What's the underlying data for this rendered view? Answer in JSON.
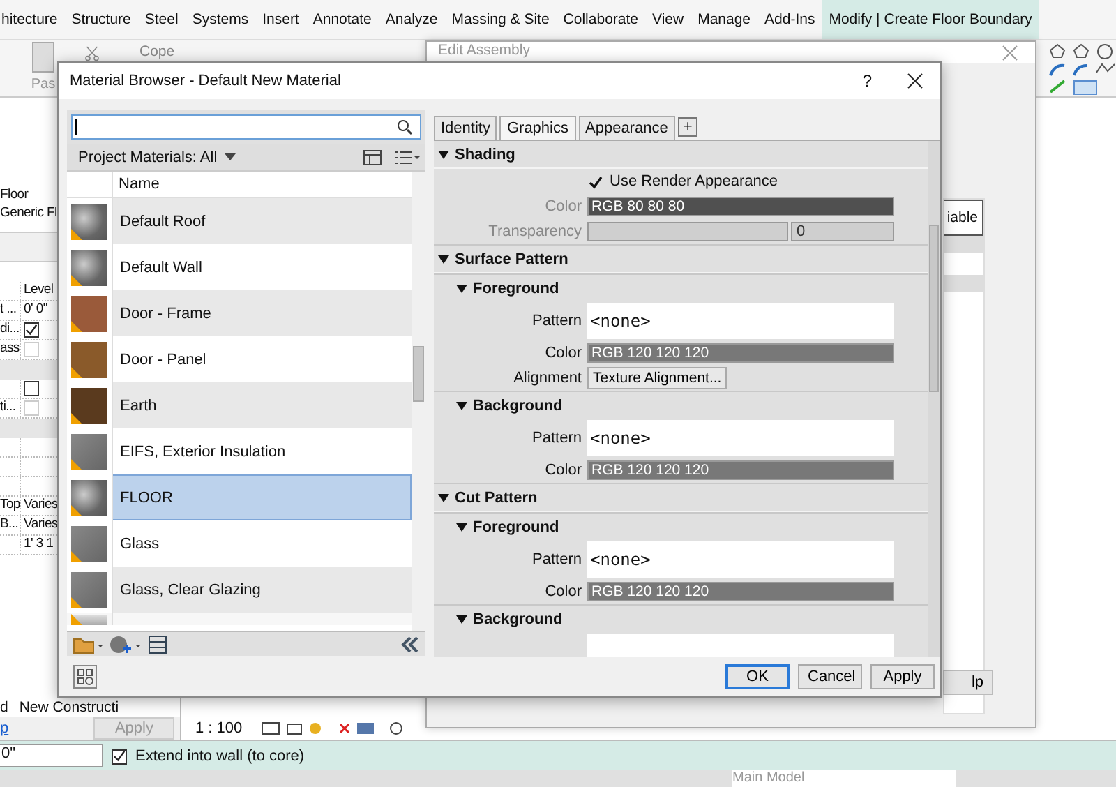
{
  "ribbon": {
    "tabs": [
      {
        "label": "hitecture",
        "selected": false
      },
      {
        "label": "Structure",
        "selected": false
      },
      {
        "label": "Steel",
        "selected": false
      },
      {
        "label": "Systems",
        "selected": false
      },
      {
        "label": "Insert",
        "selected": false
      },
      {
        "label": "Annotate",
        "selected": false
      },
      {
        "label": "Analyze",
        "selected": false
      },
      {
        "label": "Massing & Site",
        "selected": false
      },
      {
        "label": "Collaborate",
        "selected": false
      },
      {
        "label": "View",
        "selected": false
      },
      {
        "label": "Manage",
        "selected": false
      },
      {
        "label": "Add-Ins",
        "selected": false
      },
      {
        "label": "Modify | Create Floor Boundary",
        "selected": true
      }
    ],
    "paste_label": "Pas",
    "cope_label": "Cope"
  },
  "properties": {
    "type_lines": [
      "Floor",
      "Generic Fl"
    ],
    "rows": [
      {
        "kind": "text",
        "value": "Level"
      },
      {
        "kind": "text",
        "label": "t ...",
        "value": "0'  0\""
      },
      {
        "kind": "check",
        "label": "di...",
        "checked": true,
        "disabled": false
      },
      {
        "kind": "check",
        "label": "ass",
        "checked": false,
        "disabled": true
      },
      {
        "kind": "band"
      },
      {
        "kind": "check",
        "checked": false,
        "disabled": false
      },
      {
        "kind": "check",
        "label": "ti...",
        "checked": false,
        "disabled": true
      },
      {
        "kind": "band"
      },
      {
        "kind": "text"
      },
      {
        "kind": "text"
      },
      {
        "kind": "text"
      },
      {
        "kind": "text",
        "label": "Top",
        "value": "Varies"
      },
      {
        "kind": "text",
        "label": "B...",
        "value": "Varies"
      },
      {
        "kind": "text",
        "value": "1'  3 1"
      }
    ],
    "phase_label": "d",
    "phase_value": "New Constructi",
    "help_link": "p",
    "apply": {
      "label": "Apply",
      "disabled": true
    }
  },
  "view_bar": {
    "scale": "1 : 100"
  },
  "options_bar": {
    "offset_value": "0\"",
    "extend_label": "Extend into wall (to core)",
    "extend_checked": true
  },
  "status_bar": {
    "model": "Main Model"
  },
  "edit_assembly": {
    "title": "Edit Assembly",
    "column_header": "iable",
    "help_button": "lp"
  },
  "material_browser": {
    "title": "Material Browser - Default New Material",
    "help": "?",
    "filter": "Project Materials: All",
    "column": "Name",
    "materials": [
      {
        "name": "Default Roof",
        "kind": "sphere",
        "selected": false
      },
      {
        "name": "Default Wall",
        "kind": "sphere",
        "selected": false
      },
      {
        "name": "Door - Frame",
        "kind": "wood",
        "selected": false
      },
      {
        "name": "Door - Panel",
        "kind": "panel",
        "selected": false
      },
      {
        "name": "Earth",
        "kind": "earth",
        "selected": false
      },
      {
        "name": "EIFS, Exterior Insulation",
        "kind": "box",
        "selected": false
      },
      {
        "name": "FLOOR",
        "kind": "sphere",
        "selected": true
      },
      {
        "name": "Glass",
        "kind": "box",
        "selected": false
      },
      {
        "name": "Glass, Clear Glazing",
        "kind": "box",
        "selected": false
      },
      {
        "kind": "slab",
        "selected": false
      }
    ],
    "tabs": [
      {
        "label": "Identity",
        "selected": false
      },
      {
        "label": "Graphics",
        "selected": true
      },
      {
        "label": "Appearance",
        "selected": false
      },
      {
        "label": "+",
        "selected": false
      }
    ],
    "sections": [
      {
        "title": "Shading",
        "expanded": true,
        "rows": [
          {
            "kind": "checkbox",
            "label": "Use Render Appearance",
            "checked": true
          },
          {
            "kind": "swatch",
            "label": "Color",
            "value": "RGB 80 80 80",
            "color": "#505050",
            "disabled": true
          },
          {
            "kind": "slider",
            "label": "Transparency",
            "value": "0",
            "disabled": true
          }
        ]
      },
      {
        "title": "Surface Pattern",
        "expanded": true,
        "groups": [
          {
            "title": "Foreground",
            "expanded": true,
            "rows": [
              {
                "kind": "pattern",
                "label": "Pattern",
                "value": "<none>"
              },
              {
                "kind": "swatch",
                "label": "Color",
                "value": "RGB 120 120 120",
                "color": "#787878",
                "disabled": false
              },
              {
                "kind": "button",
                "label": "Alignment",
                "value": "Texture Alignment..."
              }
            ]
          },
          {
            "title": "Background",
            "expanded": true,
            "rows": [
              {
                "kind": "pattern",
                "label": "Pattern",
                "value": "<none>"
              },
              {
                "kind": "swatch",
                "label": "Color",
                "value": "RGB 120 120 120",
                "color": "#787878",
                "disabled": false
              }
            ]
          }
        ]
      },
      {
        "title": "Cut Pattern",
        "expanded": true,
        "groups": [
          {
            "title": "Foreground",
            "expanded": true,
            "rows": [
              {
                "kind": "pattern",
                "label": "Pattern",
                "value": "<none>"
              },
              {
                "kind": "swatch",
                "label": "Color",
                "value": "RGB 120 120 120",
                "color": "#787878",
                "disabled": false
              }
            ]
          },
          {
            "title": "Background",
            "expanded": true,
            "rows": [
              {
                "kind": "pattern"
              }
            ]
          }
        ]
      }
    ],
    "buttons": [
      {
        "label": "OK",
        "default": true
      },
      {
        "label": "Cancel",
        "default": false
      },
      {
        "label": "Apply",
        "default": false
      }
    ]
  }
}
